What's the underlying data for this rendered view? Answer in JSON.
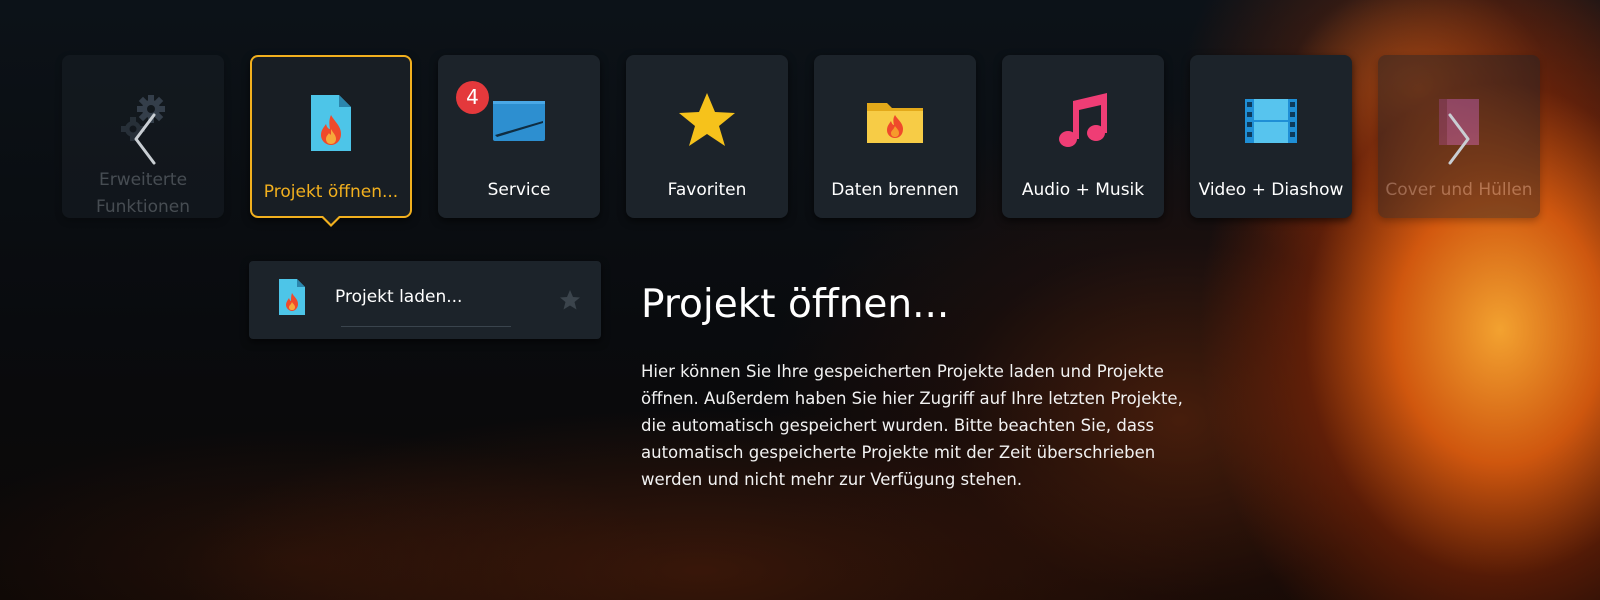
{
  "nav": {
    "prev_arrow": "chevron-left",
    "next_arrow": "chevron-right"
  },
  "tiles": [
    {
      "id": "erweiterte-funktionen",
      "label": "Erweiterte Funktionen",
      "icon": "gears-icon",
      "state": "dimmed"
    },
    {
      "id": "projekt-oeffnen",
      "label": "Projekt öffnen...",
      "icon": "project-file-flame-icon",
      "state": "selected"
    },
    {
      "id": "service",
      "label": "Service",
      "icon": "service-window-icon",
      "badge": "4"
    },
    {
      "id": "favoriten",
      "label": "Favoriten",
      "icon": "star-icon"
    },
    {
      "id": "daten-brennen",
      "label": "Daten brennen",
      "icon": "folder-flame-icon"
    },
    {
      "id": "audio-musik",
      "label": "Audio + Musik",
      "icon": "music-note-icon"
    },
    {
      "id": "video-diashow",
      "label": "Video + Diashow",
      "icon": "film-strip-icon"
    },
    {
      "id": "cover-huellen",
      "label": "Cover und Hüllen",
      "icon": "cover-icon",
      "state": "dimmed"
    }
  ],
  "submenu": {
    "items": [
      {
        "label": "Projekt laden...",
        "icon": "project-file-flame-icon",
        "favorite_icon": "star-icon"
      }
    ]
  },
  "description": {
    "title": "Projekt öffnen...",
    "body": "Hier können Sie Ihre gespeicherten Projekte laden und Projekte öffnen. Außerdem haben Sie hier Zugriff auf Ihre letzten Projekte, die automatisch gespeichert wurden. Bitte beachten Sie, dass automatisch gespeicherte Projekte mit der Zeit überschrieben werden und nicht mehr zur Verfügung stehen."
  },
  "colors": {
    "accent": "#f2b01e",
    "tile_bg": "#1c232a",
    "badge": "#e4393c"
  }
}
